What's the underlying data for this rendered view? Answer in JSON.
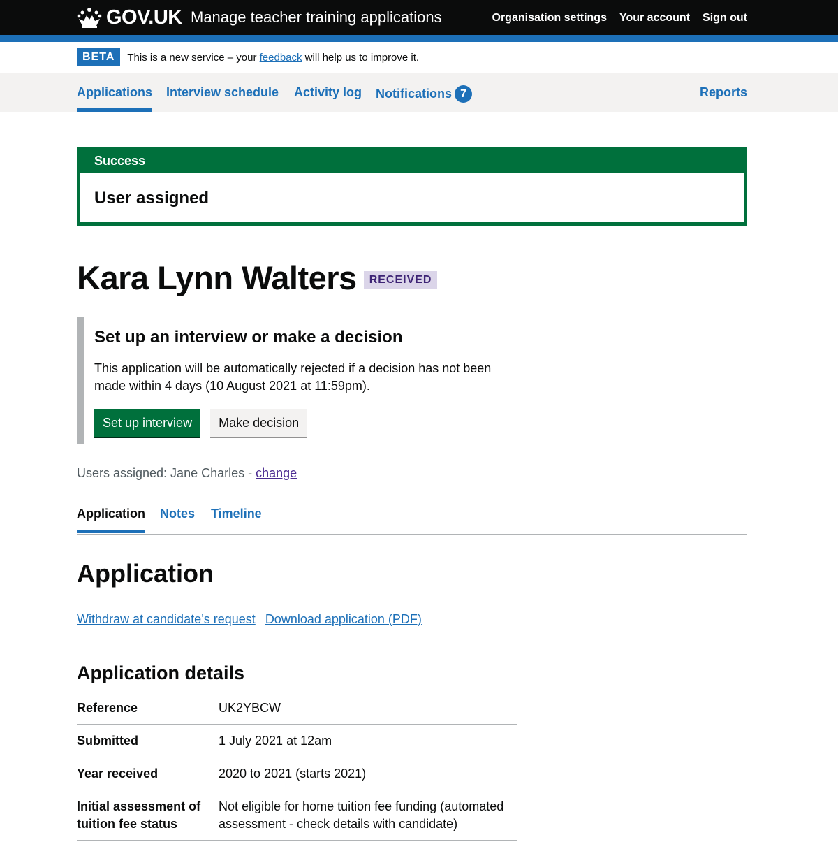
{
  "header": {
    "logo_text": "GOV.UK",
    "service_name": "Manage teacher training applications",
    "nav": [
      "Organisation settings",
      "Your account",
      "Sign out"
    ]
  },
  "phase_banner": {
    "tag": "BETA",
    "text_before": "This is a new service – your ",
    "link": "feedback",
    "text_after": " will help us to improve it."
  },
  "primary_nav": {
    "applications": "Applications",
    "interview_schedule": "Interview schedule",
    "activity_log": "Activity log",
    "notifications": "Notifications",
    "notifications_count": "7",
    "reports": "Reports"
  },
  "success": {
    "title": "Success",
    "message": "User assigned"
  },
  "candidate": {
    "name": "Kara Lynn Walters",
    "status": "RECEIVED"
  },
  "inset": {
    "heading": "Set up an interview or make a decision",
    "text": "This application will be automatically rejected if a decision has not been made within 4 days (10 August 2021 at 11:59pm).",
    "primary_button": "Set up interview",
    "secondary_button": "Make decision"
  },
  "assigned": {
    "text": "Users assigned: Jane Charles - ",
    "link": "change"
  },
  "tabs": [
    "Application",
    "Notes",
    "Timeline"
  ],
  "section_title": "Application",
  "actions": [
    "Withdraw at candidate’s request",
    "Download application (PDF)"
  ],
  "details": {
    "heading": "Application details",
    "rows": [
      {
        "key": "Reference",
        "value": "UK2YBCW"
      },
      {
        "key": "Submitted",
        "value": "1 July 2021 at 12am"
      },
      {
        "key": "Year received",
        "value": "2020 to 2021 (starts 2021)"
      },
      {
        "key": "Initial assessment of tuition fee status",
        "value": "Not eligible for home tuition fee funding (automated assessment - check details with candidate)"
      }
    ]
  }
}
